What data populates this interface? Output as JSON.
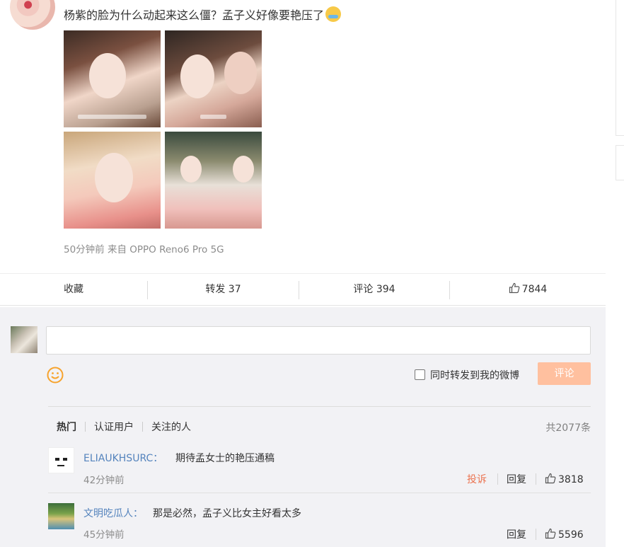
{
  "post": {
    "text": "杨紫的脸为什么动起来这么僵？孟子义好像要艳压了",
    "emoji": "cry-laugh-icon",
    "meta": "50分钟前  来自 OPPO Reno6 Pro 5G"
  },
  "actions": {
    "favorite": "收藏",
    "repost": "转发 37",
    "comment": "评论 394",
    "like": "7844"
  },
  "compose": {
    "placeholder": "",
    "repost_label": "同时转发到我的微博",
    "submit": "评论"
  },
  "tabs": [
    "热门",
    "认证用户",
    "关注的人"
  ],
  "total": "共2077条",
  "comments": [
    {
      "user": "ELIAUKHSURC",
      "text": "期待孟女士的艳压通稿",
      "time": "42分钟前",
      "report": "投诉",
      "reply": "回复",
      "likes": "3818"
    },
    {
      "user": "文明吃瓜人",
      "text": "那是必然，孟子义比女主好看太多",
      "time": "45分钟前",
      "reply": "回复",
      "likes": "5596"
    }
  ],
  "colors": {
    "link": "#5584bd",
    "accent": "#ff8140",
    "submit_disabled": "#ffc09f",
    "report": "#eb7350"
  }
}
